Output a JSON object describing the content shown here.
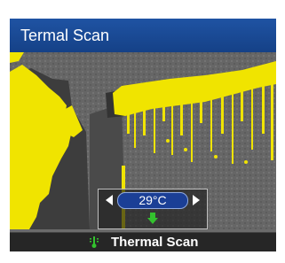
{
  "window": {
    "title": "Termal Scan"
  },
  "readout": {
    "temperature": "29°C"
  },
  "footer": {
    "label": "Thermal Scan",
    "icon": "thermometer-icon"
  },
  "colors": {
    "title_bar": "#1f53a3",
    "heat_overlay": "#f0e400",
    "pill": "#1b3f96",
    "down_arrow": "#33c22e"
  }
}
